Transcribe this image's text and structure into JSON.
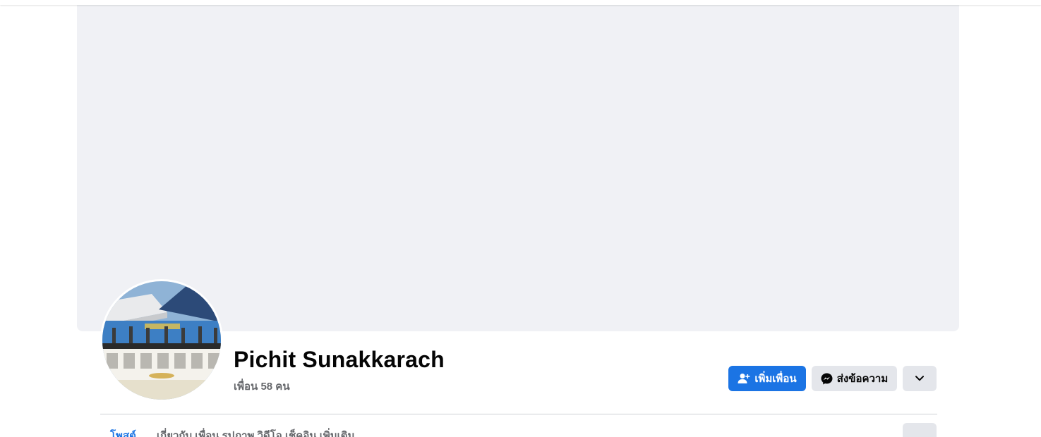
{
  "profile": {
    "name": "Pichit Sunakkarach",
    "friends": "เพื่อน 58 คน"
  },
  "actions": {
    "add_friend": "เพิ่มเพื่อน",
    "message": "ส่งข้อความ"
  },
  "icons": {
    "add_friend": "person-plus-icon",
    "message": "messenger-icon",
    "more": "chevron-down-icon"
  },
  "tabs": {
    "active": "โพสต์",
    "others": "เกี่ยวกับ เพื่อน รูปภาพ วิดีโอ เช็คอิน เพิ่มเติม"
  },
  "colors": {
    "primary": "#1b74e4",
    "secondary_bg": "#e4e6eb",
    "cover_bg": "#f0f1f5",
    "text_primary": "#050505",
    "text_secondary": "#65676b"
  }
}
